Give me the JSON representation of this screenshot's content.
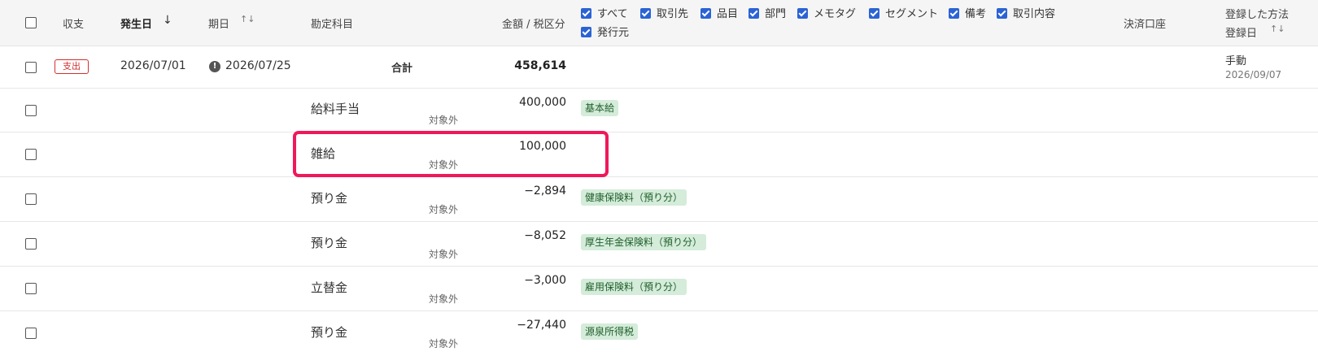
{
  "header": {
    "type_label": "収支",
    "date_label": "発生日",
    "due_label": "期日",
    "account_label": "勘定科目",
    "amount_label": "金額 / 税区分",
    "filters": [
      "すべて",
      "取引先",
      "品目",
      "部門",
      "メモタグ",
      "セグメント",
      "備考",
      "取引内容",
      "発行元"
    ],
    "payment_label": "決済口座",
    "method_label": "登録した方法",
    "reg_date_label": "登録日"
  },
  "summary": {
    "type_badge": "支出",
    "date": "2026/07/01",
    "due_date": "2026/07/25",
    "total_label": "合計",
    "total_amount": "458,614",
    "method": "手動",
    "reg_date": "2026/09/07"
  },
  "lines": [
    {
      "account": "給料手当",
      "amount": "400,000",
      "tax": "対象外",
      "tag": "基本給"
    },
    {
      "account": "雑給",
      "amount": "100,000",
      "tax": "対象外",
      "tag": ""
    },
    {
      "account": "預り金",
      "amount": "−2,894",
      "tax": "対象外",
      "tag": "健康保険料（預り分）"
    },
    {
      "account": "預り金",
      "amount": "−8,052",
      "tax": "対象外",
      "tag": "厚生年金保険料（預り分）"
    },
    {
      "account": "立替金",
      "amount": "−3,000",
      "tax": "対象外",
      "tag": "雇用保険料（預り分）"
    },
    {
      "account": "預り金",
      "amount": "−27,440",
      "tax": "対象外",
      "tag": "源泉所得税"
    }
  ]
}
